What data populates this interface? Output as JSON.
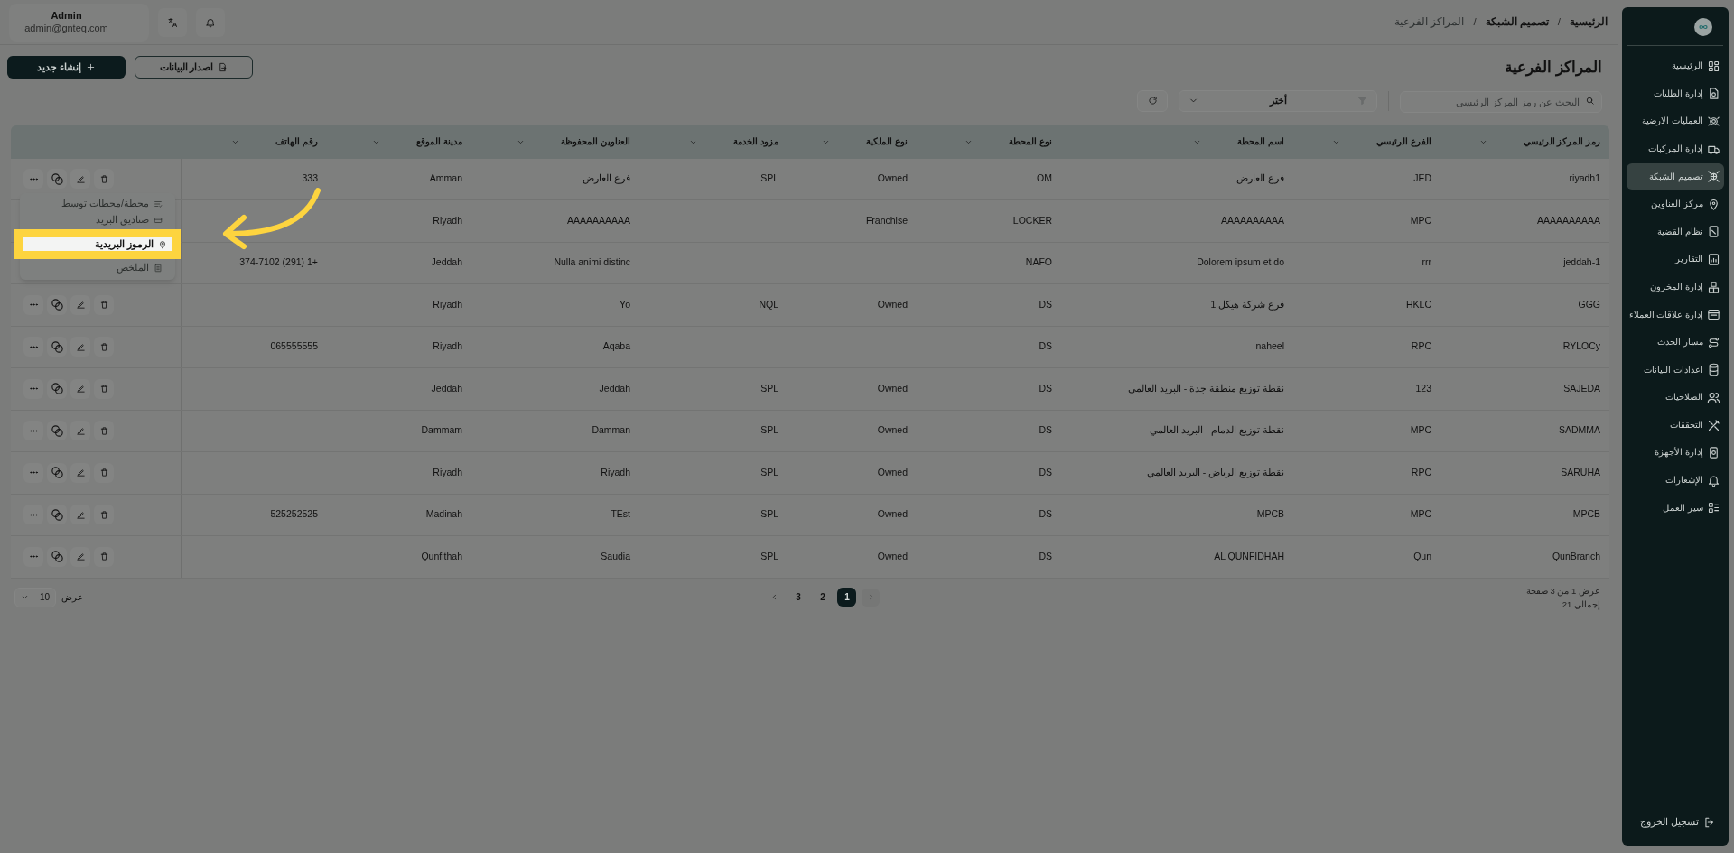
{
  "user": {
    "name": "Admin",
    "email": "admin@gnteq.com"
  },
  "breadcrumb_separator": [
    "/",
    "/"
  ],
  "breadcrumb": [
    {
      "label": "الرئيسية",
      "current": false
    },
    {
      "label": "تصميم الشبكة",
      "current": false
    },
    {
      "label": "المراكز الفرعية",
      "current": true
    }
  ],
  "page_title": "المراكز الفرعية",
  "buttons": {
    "export": "اصدار البيانات",
    "create": "إنشاء جديد"
  },
  "search": {
    "placeholder": "البحث عن رمز المركز الرئيسي"
  },
  "filter": {
    "value": "أختر"
  },
  "table": {
    "columns": [
      {
        "label": "رمز المركز الرئيسي"
      },
      {
        "label": "الفرع الرئيسي"
      },
      {
        "label": "اسم المحطة"
      },
      {
        "label": "نوع المحطة"
      },
      {
        "label": "نوع الملكية"
      },
      {
        "label": "مزود الخدمة"
      },
      {
        "label": "العناوين المحفوظة"
      },
      {
        "label": "مدينة الموقع"
      },
      {
        "label": "رقم الهاتف"
      }
    ],
    "rows": [
      {
        "code": "riyadh1",
        "main_branch": "JED",
        "station_name": "فرع العارض",
        "station_type": "OM",
        "ownership": "Owned",
        "provider": "SPL",
        "saved_address": "فرع العارض",
        "city": "Amman",
        "phone": "333"
      },
      {
        "code": "AAAAAAAAAA",
        "main_branch": "MPC",
        "station_name": "AAAAAAAAAA",
        "station_type": "LOCKER",
        "ownership": "Franchise",
        "saved_address": "AAAAAAAAAA",
        "city": "Riyadh"
      },
      {
        "code": "jeddah-1",
        "main_branch": "rrr",
        "station_name": "Dolorem ipsum et do",
        "station_type": "NAFO",
        "saved_address": "Nulla animi distinc",
        "city": "Jeddah",
        "phone": "+1 (291) 374-7102"
      },
      {
        "code": "GGG",
        "main_branch": "HKLC",
        "station_name": "فرع شركة هيكل 1",
        "station_type": "DS",
        "ownership": "Owned",
        "provider": "NQL",
        "saved_address": "Yo",
        "city": "Riyadh"
      },
      {
        "code": "RYLOCy",
        "main_branch": "RPC",
        "station_name": "naheel",
        "station_type": "DS",
        "saved_address": "Aqaba",
        "city": "Riyadh",
        "phone": "065555555"
      },
      {
        "code": "SAJEDA",
        "main_branch": "123",
        "station_name": "نقطة توزيع منطقة جدة - البريد العالمي",
        "station_type": "DS",
        "ownership": "Owned",
        "provider": "SPL",
        "saved_address": "Jeddah",
        "city": "Jeddah"
      },
      {
        "code": "SADMMA",
        "main_branch": "MPC",
        "station_name": "نقطة توزيع الدمام - البريد العالمي",
        "station_type": "DS",
        "ownership": "Owned",
        "provider": "SPL",
        "saved_address": "Damman",
        "city": "Dammam"
      },
      {
        "code": "SARUHA",
        "main_branch": "RPC",
        "station_name": "نقطة توزيع الرياض - البريد العالمي",
        "station_type": "DS",
        "ownership": "Owned",
        "provider": "SPL",
        "saved_address": "Riyadh",
        "city": "Riyadh"
      },
      {
        "code": "MPCB",
        "main_branch": "MPC",
        "station_name": "MPCB",
        "station_type": "DS",
        "ownership": "Owned",
        "provider": "SPL",
        "saved_address": "TEst",
        "city": "Madinah",
        "phone": "525252525"
      },
      {
        "code": "QunBranch",
        "main_branch": "Qun",
        "station_name": "AL QUNFIDHAH",
        "station_type": "DS",
        "ownership": "Owned",
        "provider": "SPL",
        "saved_address": "Saudia",
        "city": "Qunfithah"
      }
    ]
  },
  "row_menu": [
    {
      "label": "محطة/محطات توسط",
      "selected": false
    },
    {
      "label": "صناديق البريد",
      "selected": false
    },
    {
      "label": "الرموز البريدية",
      "selected": true
    },
    {
      "label": "الملخص",
      "selected": false
    }
  ],
  "pagination": {
    "page_size_label": "عرض",
    "page_size": "10",
    "pages": [
      {
        "label": "1",
        "selected": true
      },
      {
        "label": "2",
        "selected": false
      },
      {
        "label": "3",
        "selected": false
      }
    ],
    "summary": "عرض 1 من 3 صفحة",
    "total": "إجمالي 21"
  },
  "sidebar": {
    "items": [
      {
        "label": "الرئيسية",
        "selected": false
      },
      {
        "label": "إدارة الطلبات",
        "selected": false
      },
      {
        "label": "العمليات الارضية",
        "selected": false
      },
      {
        "label": "إدارة المركبات",
        "selected": false
      },
      {
        "label": "تصميم الشبكة",
        "selected": true
      },
      {
        "label": "مركز العناوين",
        "selected": false
      },
      {
        "label": "نظام القضية",
        "selected": false
      },
      {
        "label": "التقارير",
        "selected": false
      },
      {
        "label": "إدارة المخزون",
        "selected": false
      },
      {
        "label": "إدارة علاقات العملاء",
        "selected": false
      },
      {
        "label": "مسار الحدث",
        "selected": false
      },
      {
        "label": "اعدادات البيانات",
        "selected": false
      },
      {
        "label": "الصلاحيات",
        "selected": false
      },
      {
        "label": "التحققات",
        "selected": false
      },
      {
        "label": "إدارة الأجهزة",
        "selected": false
      },
      {
        "label": "الإشعارات",
        "selected": false
      },
      {
        "label": "سير العمل",
        "selected": false
      }
    ],
    "logout": "تسجيل الخروج"
  }
}
